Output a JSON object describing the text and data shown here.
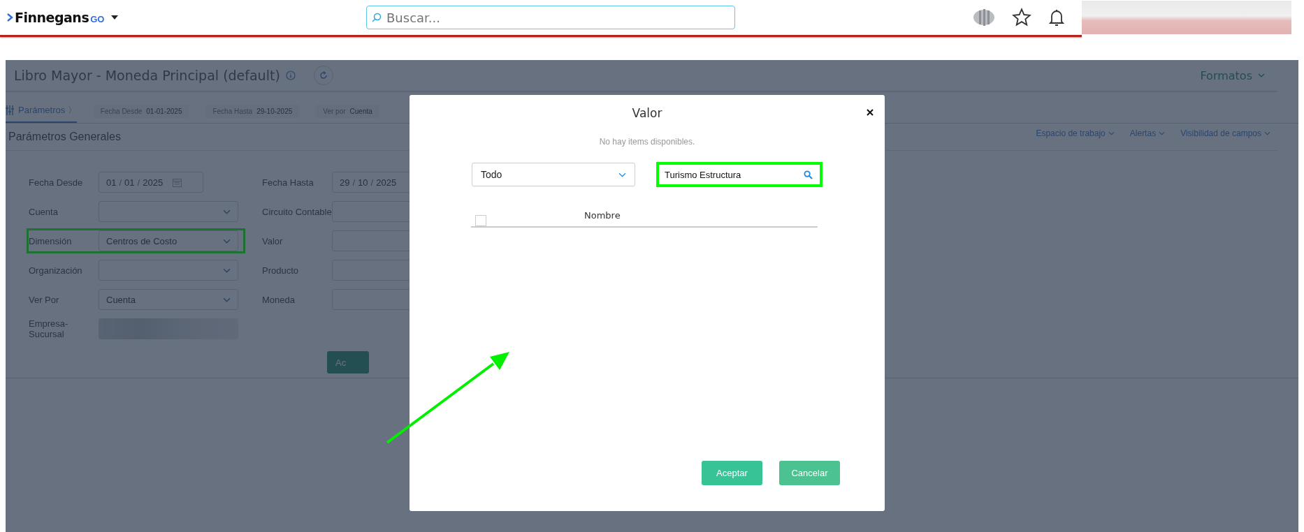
{
  "header": {
    "logo_text": "Finnegans",
    "logo_suffix": "GO",
    "search_placeholder": "Buscar..."
  },
  "page": {
    "title": "Libro Mayor - Moneda Principal (default)",
    "formats": "Formatos",
    "tab": {
      "label": "Parámetros",
      "suffix": "〉",
      "selected": true
    },
    "date_separator": "/",
    "summary": [
      {
        "label": "Fecha Desde",
        "value": "01-01-2025"
      },
      {
        "label": "Fecha Hasta",
        "value": "29-10-2025"
      },
      {
        "label": "Ver por",
        "value": "Cuenta"
      }
    ],
    "toolbar_links": [
      "Espacio de trabajo",
      "Alertas",
      "Visibilidad de campos"
    ],
    "section_title": "Parámetros Generales",
    "left_fields": [
      {
        "label": "Fecha Desde",
        "kind": "date",
        "parts": [
          "01",
          "01",
          "2025"
        ],
        "highlighted": false
      },
      {
        "label": "Cuenta",
        "kind": "select",
        "highlighted": false
      },
      {
        "label": "Dimensión",
        "kind": "select",
        "value": "Centros de Costo",
        "highlighted": true
      },
      {
        "label": "Organización",
        "kind": "select",
        "highlighted": false
      },
      {
        "label": "Ver Por",
        "kind": "select",
        "value": "Cuenta",
        "highlighted": false
      },
      {
        "label": "Empresa-Sucursal",
        "kind": "blurred",
        "highlighted": false
      }
    ],
    "right_fields": [
      {
        "label": "Fecha Hasta",
        "kind": "date",
        "parts": [
          "29",
          "10",
          "2025"
        ]
      },
      {
        "label": "Circuito Contable",
        "kind": "text"
      },
      {
        "label": "Valor",
        "kind": "text"
      },
      {
        "label": "Producto",
        "kind": "text"
      },
      {
        "label": "Moneda",
        "kind": "text"
      }
    ],
    "action_button": "Ac"
  },
  "modal": {
    "title": "Valor",
    "message": "No hay items disponibles.",
    "filter": "Todo",
    "search_value": "Turismo Estructura",
    "search_highlighted": true,
    "column": "Nombre",
    "select_all_checked": false,
    "buttons": [
      {
        "label": "Aceptar",
        "kind": "primary"
      },
      {
        "label": "Cancelar",
        "kind": "secondary"
      }
    ]
  }
}
